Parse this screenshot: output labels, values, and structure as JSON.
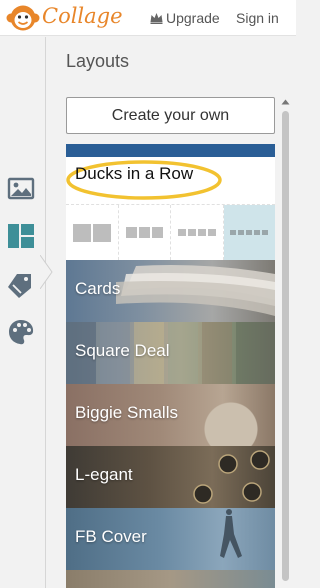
{
  "app": {
    "brand": "Collage",
    "upgrade_label": "Upgrade",
    "signin_label": "Sign in"
  },
  "panel": {
    "title": "Layouts",
    "create_label": "Create your own"
  },
  "selected_layout": {
    "name": "Ducks in a Row",
    "selected_variant_index": 3
  },
  "layouts": [
    {
      "name": "Cards"
    },
    {
      "name": "Square Deal"
    },
    {
      "name": "Biggie Smalls"
    },
    {
      "name": "L-egant"
    },
    {
      "name": "FB Cover"
    }
  ],
  "rail": [
    "photo-icon",
    "layouts-icon",
    "tag-icon",
    "palette-icon"
  ],
  "colors": {
    "brand": "#e8862a",
    "highlight": "#f2c230",
    "active_variant": "#cfe4ea"
  }
}
